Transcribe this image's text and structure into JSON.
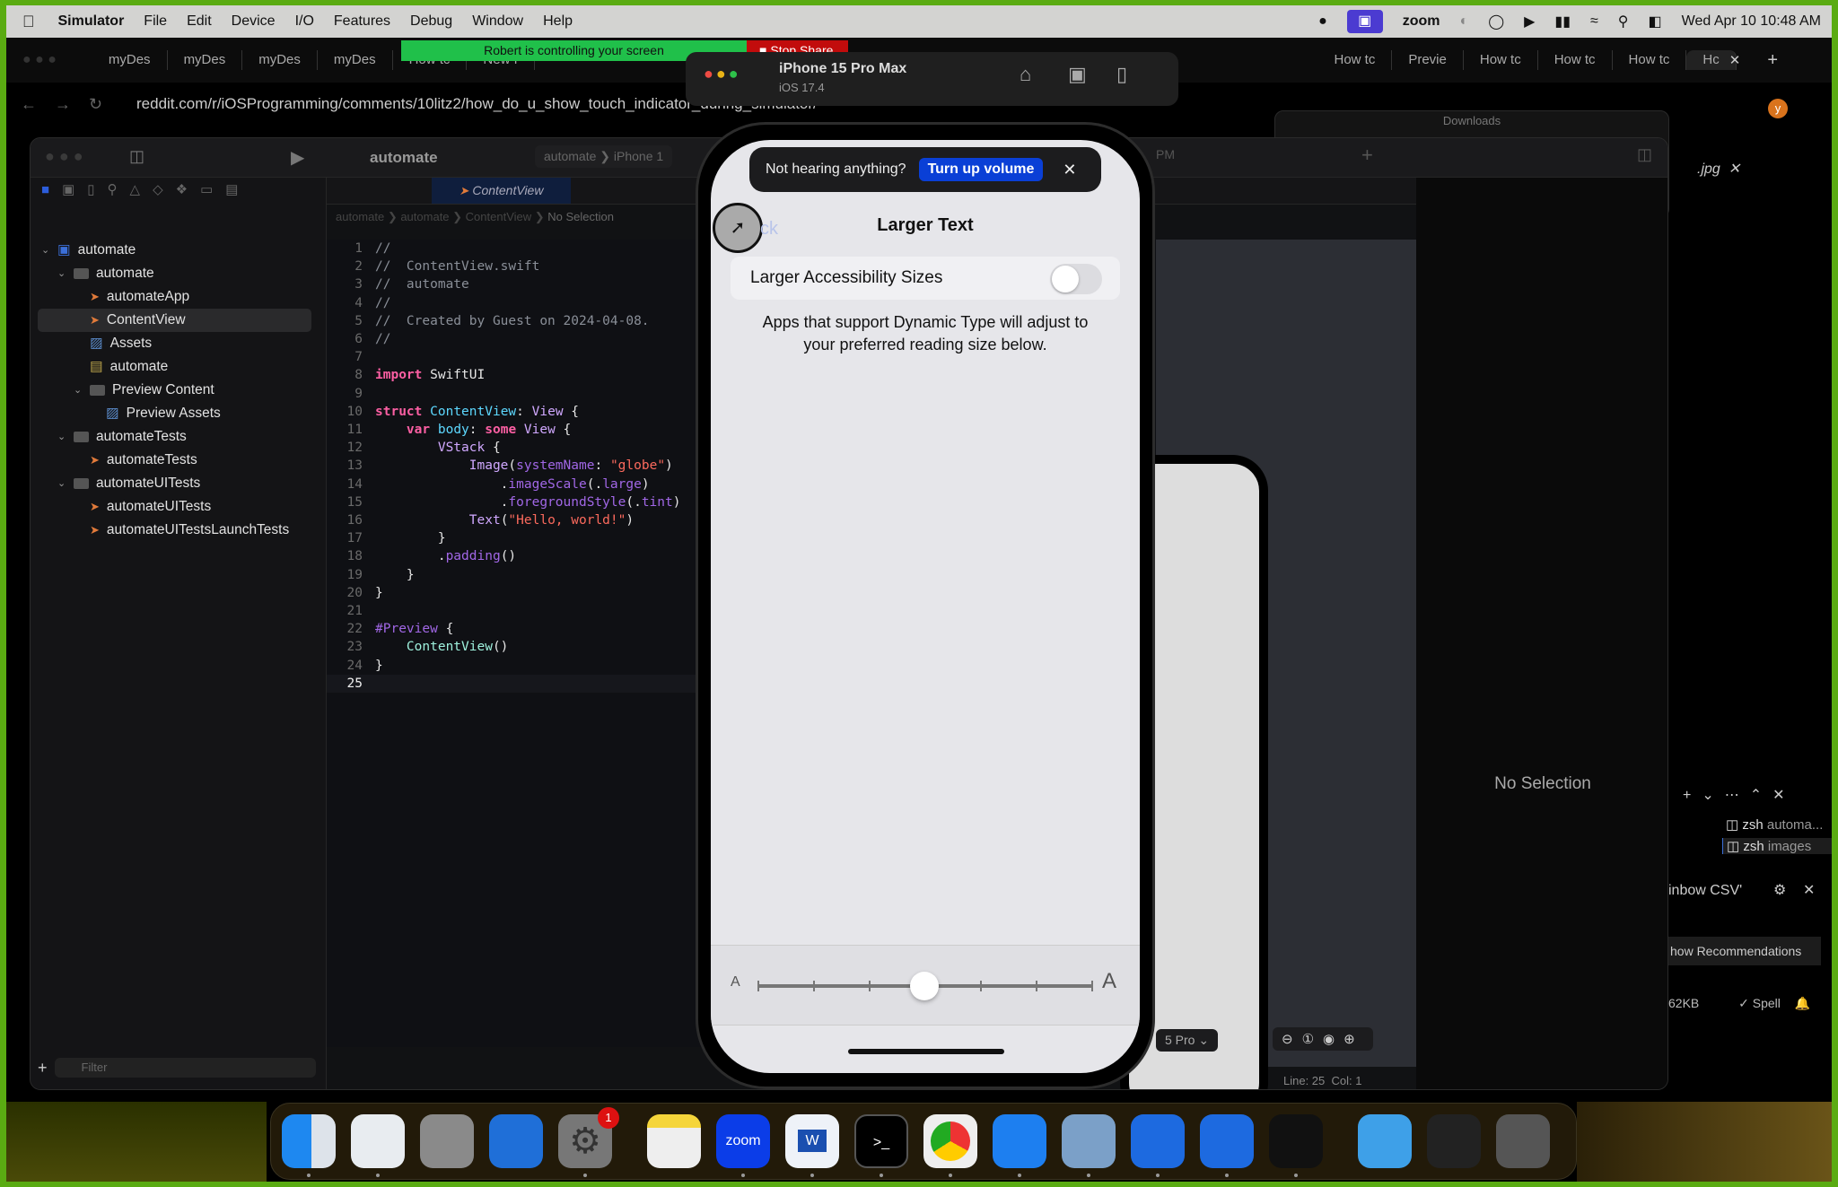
{
  "menubar": {
    "app": "Simulator",
    "items": [
      "File",
      "Edit",
      "Device",
      "I/O",
      "Features",
      "Debug",
      "Window",
      "Help"
    ],
    "zoom_label": "zoom",
    "datetime": "Wed Apr 10  10:48 AM"
  },
  "zoom_share": {
    "message": "Robert is controlling your screen",
    "stop": "Stop Share"
  },
  "browser": {
    "tabs_left": [
      "myDes",
      "myDes",
      "myDes",
      "myDes",
      "How tc",
      "New f"
    ],
    "tabs_right": [
      "How tc",
      "Previe",
      "How tc",
      "How tc",
      "How tc",
      "Hc"
    ],
    "url": "reddit.com/r/iOSProgramming/comments/10litz2/how_do_u_show_touch_indicator_during_simulator/",
    "downloads_title": "Downloads",
    "file_tab": ".jpg",
    "avatar": "y"
  },
  "simulator": {
    "device": "iPhone 15 Pro Max",
    "os": "iOS 17.4"
  },
  "xcode": {
    "project": "automate",
    "scheme": "automate",
    "destination": "iPhone 1",
    "editor_tab": "ContentView",
    "breadcrumb": [
      "automate",
      "automate",
      "ContentView",
      "No Selection"
    ],
    "time_badge": "PM",
    "navigator": [
      {
        "label": "automate",
        "depth": 0,
        "kind": "project",
        "open": true
      },
      {
        "label": "automate",
        "depth": 1,
        "kind": "folder",
        "open": true
      },
      {
        "label": "automateApp",
        "depth": 2,
        "kind": "swift"
      },
      {
        "label": "ContentView",
        "depth": 2,
        "kind": "swift",
        "selected": true
      },
      {
        "label": "Assets",
        "depth": 2,
        "kind": "assets"
      },
      {
        "label": "automate",
        "depth": 2,
        "kind": "entitlements"
      },
      {
        "label": "Preview Content",
        "depth": 2,
        "kind": "folder",
        "open": true
      },
      {
        "label": "Preview Assets",
        "depth": 3,
        "kind": "assets"
      },
      {
        "label": "automateTests",
        "depth": 1,
        "kind": "folder",
        "open": true
      },
      {
        "label": "automateTests",
        "depth": 2,
        "kind": "swift"
      },
      {
        "label": "automateUITests",
        "depth": 1,
        "kind": "folder",
        "open": true
      },
      {
        "label": "automateUITests",
        "depth": 2,
        "kind": "swift"
      },
      {
        "label": "automateUITestsLaunchTests",
        "depth": 2,
        "kind": "swift"
      }
    ],
    "filter_placeholder": "Filter",
    "code": [
      [
        [
          "//",
          "cm"
        ]
      ],
      [
        [
          "//  ContentView.swift",
          "cm"
        ]
      ],
      [
        [
          "//  automate",
          "cm"
        ]
      ],
      [
        [
          "//",
          "cm"
        ]
      ],
      [
        [
          "//  Created by Guest on 2024-04-08.",
          "cm"
        ]
      ],
      [
        [
          "//",
          "cm"
        ]
      ],
      [],
      [
        [
          "import",
          "kw"
        ],
        [
          " SwiftUI",
          "pl"
        ]
      ],
      [],
      [
        [
          "struct",
          "kw"
        ],
        [
          " ",
          "pl"
        ],
        [
          "ContentView",
          "tn"
        ],
        [
          ": ",
          "pl"
        ],
        [
          "View",
          "ty"
        ],
        [
          " {",
          "pl"
        ]
      ],
      [
        [
          "    ",
          "pl"
        ],
        [
          "var",
          "kw"
        ],
        [
          " ",
          "pl"
        ],
        [
          "body",
          "tn"
        ],
        [
          ": ",
          "pl"
        ],
        [
          "some",
          "kw"
        ],
        [
          " ",
          "pl"
        ],
        [
          "View",
          "ty"
        ],
        [
          " {",
          "pl"
        ]
      ],
      [
        [
          "        ",
          "pl"
        ],
        [
          "VStack",
          "ty"
        ],
        [
          " {",
          "pl"
        ]
      ],
      [
        [
          "            ",
          "pl"
        ],
        [
          "Image",
          "ty"
        ],
        [
          "(",
          "pl"
        ],
        [
          "systemName",
          "fn"
        ],
        [
          ": ",
          "pl"
        ],
        [
          "\"globe\"",
          "st"
        ],
        [
          ")",
          "pl"
        ]
      ],
      [
        [
          "                .",
          "pl"
        ],
        [
          "imageScale",
          "fn"
        ],
        [
          "(.",
          "pl"
        ],
        [
          "large",
          "fn"
        ],
        [
          ")",
          "pl"
        ]
      ],
      [
        [
          "                .",
          "pl"
        ],
        [
          "foregroundStyle",
          "fn"
        ],
        [
          "(.",
          "pl"
        ],
        [
          "tint",
          "fn"
        ],
        [
          ")",
          "pl"
        ]
      ],
      [
        [
          "            ",
          "pl"
        ],
        [
          "Text",
          "ty"
        ],
        [
          "(",
          "pl"
        ],
        [
          "\"Hello, world!\"",
          "st"
        ],
        [
          ")",
          "pl"
        ]
      ],
      [
        [
          "        }",
          "pl"
        ]
      ],
      [
        [
          "        .",
          "pl"
        ],
        [
          "padding",
          "fn"
        ],
        [
          "()",
          "pl"
        ]
      ],
      [
        [
          "    }",
          "pl"
        ]
      ],
      [
        [
          "}",
          "pl"
        ]
      ],
      [],
      [
        [
          "#Preview",
          "pv"
        ],
        [
          " {",
          "pl"
        ]
      ],
      [
        [
          "    ",
          "pl"
        ],
        [
          "ContentView",
          "cv"
        ],
        [
          "()",
          "pl"
        ]
      ],
      [
        [
          "}",
          "pl"
        ]
      ],
      []
    ],
    "inspector_empty": "No Selection",
    "preview_device": "5 Pro",
    "status": "Line: 25  Col: 1"
  },
  "ios": {
    "banner_text": "Not hearing anything?",
    "banner_button": "Turn up volume",
    "back": "ck",
    "title": "Larger Text",
    "toggle_label": "Larger Accessibility Sizes",
    "toggle_on": false,
    "description": "Apps that support Dynamic Type will adjust to your preferred reading size below.",
    "slider_small": "A",
    "slider_large": "A",
    "slider_steps": 7,
    "slider_value_index": 3
  },
  "vscode": {
    "terminals": [
      {
        "shell": "zsh",
        "name": "automa..."
      },
      {
        "shell": "zsh",
        "name": "images"
      }
    ],
    "notification": "inbow CSV'",
    "recommend": "how Recommendations",
    "status_size": "62KB",
    "spell": "✓ Spell"
  },
  "dock": {
    "apps": [
      "Finder",
      "Visual Studio Code",
      "Launchpad",
      "Safari",
      "System Settings",
      "Notes",
      "Zoom",
      "Word",
      "Terminal",
      "Chrome",
      "App Store",
      "Preview",
      "Xcode",
      "Simulator",
      "QuickTime",
      "Downloads",
      "Screenshot",
      "Trash"
    ],
    "settings_badge": "1",
    "zoom_label": "zoom",
    "word_label": "W",
    "terminal_label": ">_"
  },
  "colors": {
    "share_green": "#20c04a",
    "share_red": "#c20c0c",
    "accent_blue": "#0a3fd6",
    "border_green": "#5aab12"
  }
}
